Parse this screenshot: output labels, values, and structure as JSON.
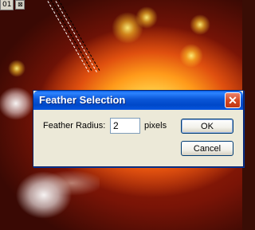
{
  "document_tab": {
    "number": "01",
    "close_glyph": "⊠"
  },
  "dialog": {
    "title": "Feather Selection",
    "close_glyph": "✕",
    "field_label": "Feather Radius:",
    "field_value": "2",
    "unit_label": "pixels",
    "ok_label": "OK",
    "cancel_label": "Cancel"
  },
  "colors": {
    "titlebar": "#0a56d8",
    "dialog_bg": "#ece9d8",
    "close_button": "#d2461f"
  }
}
